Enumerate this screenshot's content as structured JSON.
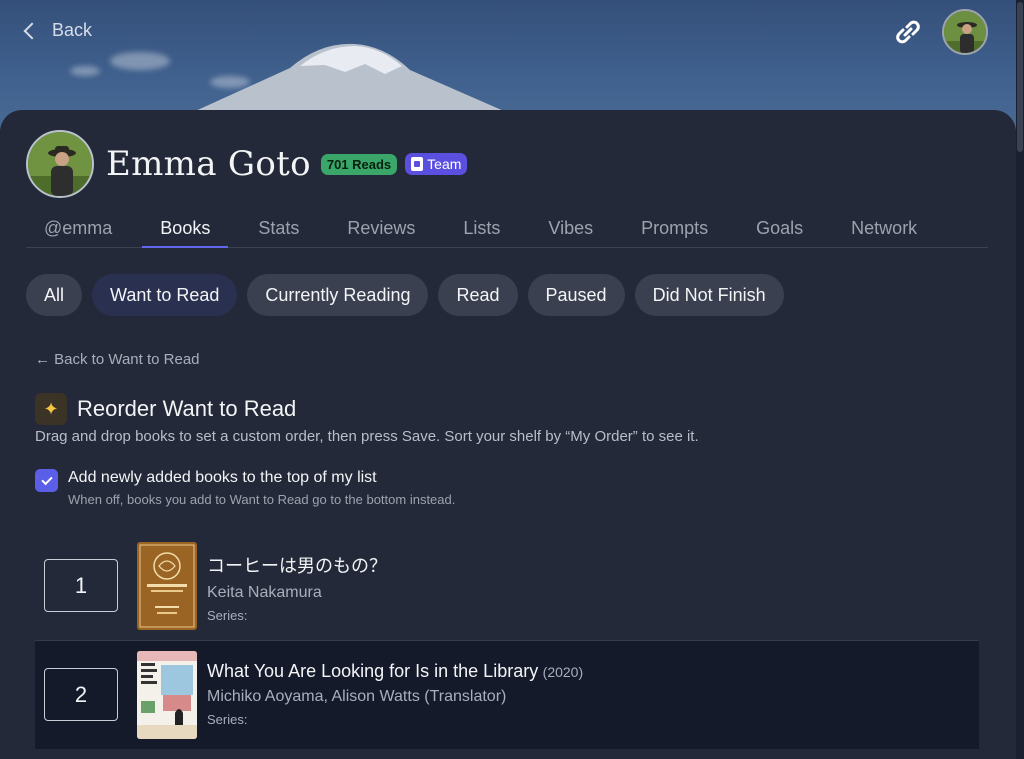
{
  "nav": {
    "back_label": "Back"
  },
  "profile": {
    "name": "Emma Goto",
    "reads_badge": "701 Reads",
    "team_badge": "Team"
  },
  "tabs": [
    {
      "label": "@emma"
    },
    {
      "label": "Books"
    },
    {
      "label": "Stats"
    },
    {
      "label": "Reviews"
    },
    {
      "label": "Lists"
    },
    {
      "label": "Vibes"
    },
    {
      "label": "Prompts"
    },
    {
      "label": "Goals"
    },
    {
      "label": "Network"
    }
  ],
  "filters": [
    {
      "label": "All"
    },
    {
      "label": "Want to Read"
    },
    {
      "label": "Currently Reading"
    },
    {
      "label": "Read"
    },
    {
      "label": "Paused"
    },
    {
      "label": "Did Not Finish"
    }
  ],
  "reorder": {
    "back_link": "← Back to Want to Read",
    "title": "Reorder Want to Read",
    "description": "Drag and drop books to set a custom order, then press Save. Sort your shelf by “My Order” to see it.",
    "checkbox_label": "Add newly added books to the top of my list",
    "checkbox_sub": "When off, books you add to Want to Read go to the bottom instead.",
    "checkbox_checked": true
  },
  "books": [
    {
      "position": "1",
      "title": "コーヒーは男のもの？",
      "year": "",
      "author": "Keita Nakamura",
      "series": "Series:"
    },
    {
      "position": "2",
      "title": "What You Are Looking for Is in the Library",
      "year": "(2020)",
      "author": "Michiko Aoyama, Alison Watts (Translator)",
      "series": "Series:"
    }
  ],
  "colors": {
    "accent": "#6366f1",
    "reads_badge": "#3aa66a",
    "team_badge": "#5b4fe0",
    "background": "#232938"
  },
  "icons": {
    "back": "chevron-left-icon",
    "link": "link-icon",
    "sparkle": "sparkle-icon",
    "check": "check-icon"
  }
}
